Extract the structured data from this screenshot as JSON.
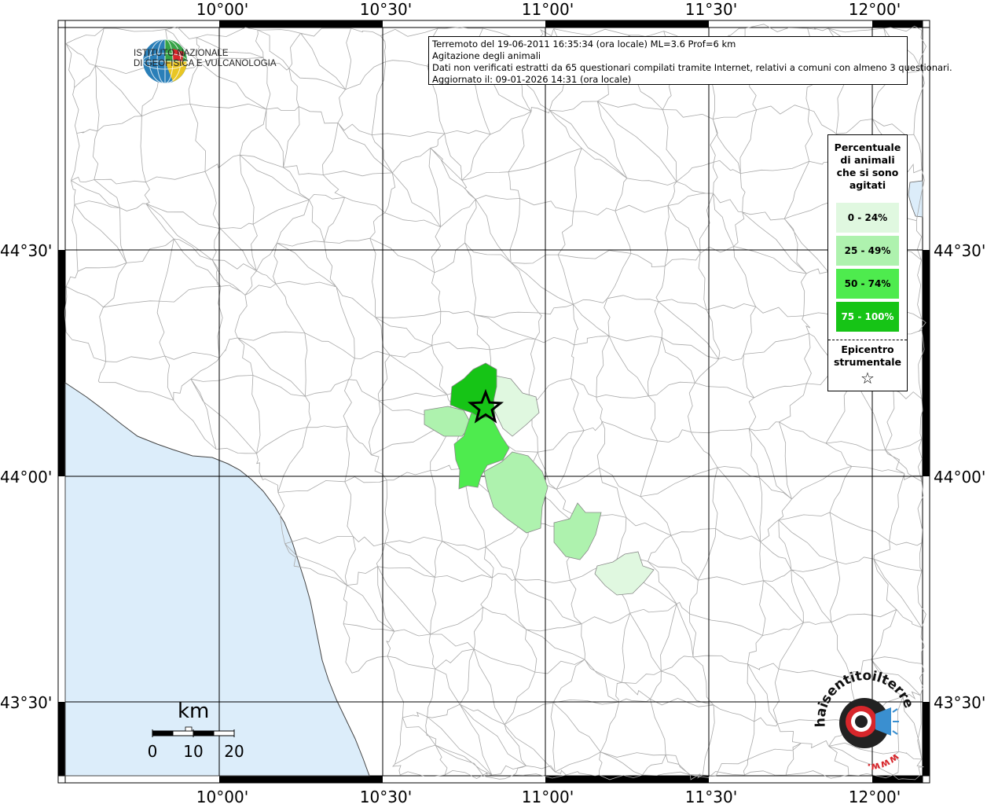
{
  "axes": {
    "lon_labels": [
      "10°00'",
      "10°30'",
      "11°00'",
      "11°30'",
      "12°00'"
    ],
    "lat_labels": [
      "44°30'",
      "44°00'",
      "43°30'"
    ]
  },
  "info": {
    "line1": "Terremoto del 19-06-2011 16:35:34 (ora locale) ML=3.6 Prof=6 km",
    "line2": "Agitazione degli animali",
    "line3": "Dati non verificati estratti da 65 questionari compilati tramite Internet, relativi a comuni con almeno 3 questionari.",
    "line4": "Aggiornato il: 09-01-2026 14:31 (ora locale)"
  },
  "ingv": {
    "line1": "ISTITUTO NAZIONALE",
    "line2": "DI GEOFISICA E VULCANOLOGIA"
  },
  "legend": {
    "title": "Percentuale di animali che si sono agitati",
    "items": [
      {
        "label": "0 - 24%",
        "color": "#e0f8e0",
        "text_color": "#000000"
      },
      {
        "label": "25 - 49%",
        "color": "#aef2ae",
        "text_color": "#000000"
      },
      {
        "label": "50 - 74%",
        "color": "#4eeb4e",
        "text_color": "#000000"
      },
      {
        "label": "75 - 100%",
        "color": "#16c416",
        "text_color": "#ffffff"
      }
    ],
    "epicenter_label": "Epicentro strumentale",
    "epicenter_symbol": "☆"
  },
  "scale": {
    "unit": "km",
    "ticks": [
      "0",
      "10",
      "20"
    ]
  },
  "hst_logo": {
    "brand": "haisentitoilterremoto.it",
    "prefix": "www."
  },
  "colors": {
    "sea": "#dcedfa",
    "border_gray": "#999999",
    "grid": "#000000"
  }
}
